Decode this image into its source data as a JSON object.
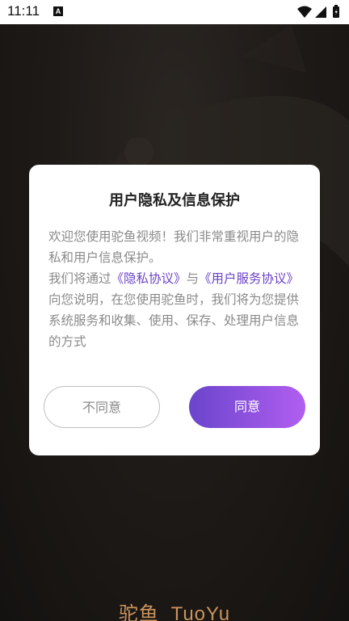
{
  "status_bar": {
    "time": "11:11",
    "indicator": "A"
  },
  "dialog": {
    "title": "用户隐私及信息保护",
    "para1": "欢迎您使用驼鱼视频！我们非常重视用户的隐私和用户信息保护。",
    "para2_prefix": "我们将通过",
    "privacy_link": "《隐私协议》",
    "para2_and": "与",
    "service_link": "《用户服务协议》",
    "para2_suffix": "向您说明，在您使用驼鱼时，我们将为您提供系统服务和收集、使用、保存、处理用户信息的方式",
    "disagree_label": "不同意",
    "agree_label": "同意"
  },
  "brand": {
    "cn": "驼鱼",
    "en": "TuoYu"
  },
  "colors": {
    "accent_start": "#6a45cc",
    "accent_end": "#b15ef0",
    "link": "#6a42c6",
    "brand_text": "#c9935c"
  }
}
